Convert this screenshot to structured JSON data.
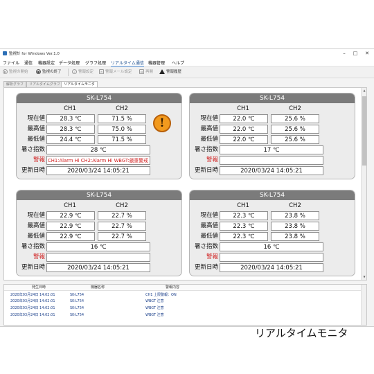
{
  "window": {
    "title": "監視計 for Windows Ver.1.0",
    "minimize": "–",
    "maximize": "□",
    "close": "✕"
  },
  "menu": [
    "ファイル",
    "通信",
    "機器設定",
    "データ処理",
    "グラフ処理",
    "リアルタイム通信",
    "機器管理",
    "ヘルプ"
  ],
  "toolbar": {
    "start": "監視の開始",
    "stop": "監視の終了",
    "alarm_settings": "警報設定",
    "alarm_mail": "警報メール設定",
    "redraw": "再開",
    "alarm_history": "警報履歴"
  },
  "tabs": [
    "解析グラフ",
    "リアルタイムグラフ",
    "リアルタイムモニタ"
  ],
  "labels": {
    "ch1": "CH1",
    "ch2": "CH2",
    "current": "現在値",
    "max": "最高値",
    "min": "最低値",
    "heat_index": "暑さ指数",
    "alarm": "警報",
    "updated": "更新日時"
  },
  "panels": [
    {
      "name": "SK-L754",
      "ch1": {
        "current": "28.3 ℃",
        "max": "28.3 ℃",
        "min": "24.4 ℃"
      },
      "ch2": {
        "current": "71.5 %",
        "max": "75.0 %",
        "min": "71.5 %"
      },
      "heat_index": "28 ℃",
      "alarm": "CH1:Alarm Hi CH2:Alarm Hi WBGT:厳重警戒",
      "updated": "2020/03/24 14:05:21",
      "alarm_icon": "!"
    },
    {
      "name": "SK-L754",
      "ch1": {
        "current": "22.0 ℃",
        "max": "22.0 ℃",
        "min": "22.0 ℃"
      },
      "ch2": {
        "current": "25.6 %",
        "max": "25.6 %",
        "min": "25.6 %"
      },
      "heat_index": "17 ℃",
      "alarm": "",
      "updated": "2020/03/24 14:05:21"
    },
    {
      "name": "SK-L754",
      "ch1": {
        "current": "22.9 ℃",
        "max": "22.9 ℃",
        "min": "22.9 ℃"
      },
      "ch2": {
        "current": "22.7 %",
        "max": "22.7 %",
        "min": "22.7 %"
      },
      "heat_index": "16 ℃",
      "alarm": "",
      "updated": "2020/03/24 14:05:21"
    },
    {
      "name": "SK-L754",
      "ch1": {
        "current": "22.3 ℃",
        "max": "22.3 ℃",
        "min": "22.3 ℃"
      },
      "ch2": {
        "current": "23.8 %",
        "max": "23.8 %",
        "min": "23.8 %"
      },
      "heat_index": "16 ℃",
      "alarm": "",
      "updated": "2020/03/24 14:05:21"
    }
  ],
  "log": {
    "columns": [
      "発生日時",
      "機器名称",
      "警報内容"
    ],
    "rows": [
      [
        "2020年03月24日 14:02:01",
        "SK-L754",
        "CH1 上限警報：ON"
      ],
      [
        "2020年03月24日 14:02:01",
        "SK-L754",
        "WBGT 注意"
      ],
      [
        "2020年03月24日 14:02:01",
        "SK-L754",
        "WBGT 注意"
      ],
      [
        "2020年03月24日 14:02:01",
        "SK-L754",
        "WBGT 注意"
      ]
    ]
  },
  "caption": "リアルタイムモニタ",
  "colors": {
    "panel_header": "#7b7b7b",
    "alarm_red": "#d01f1f",
    "alarm_icon": "#f29a1e",
    "log_text": "#1a3f8a"
  }
}
